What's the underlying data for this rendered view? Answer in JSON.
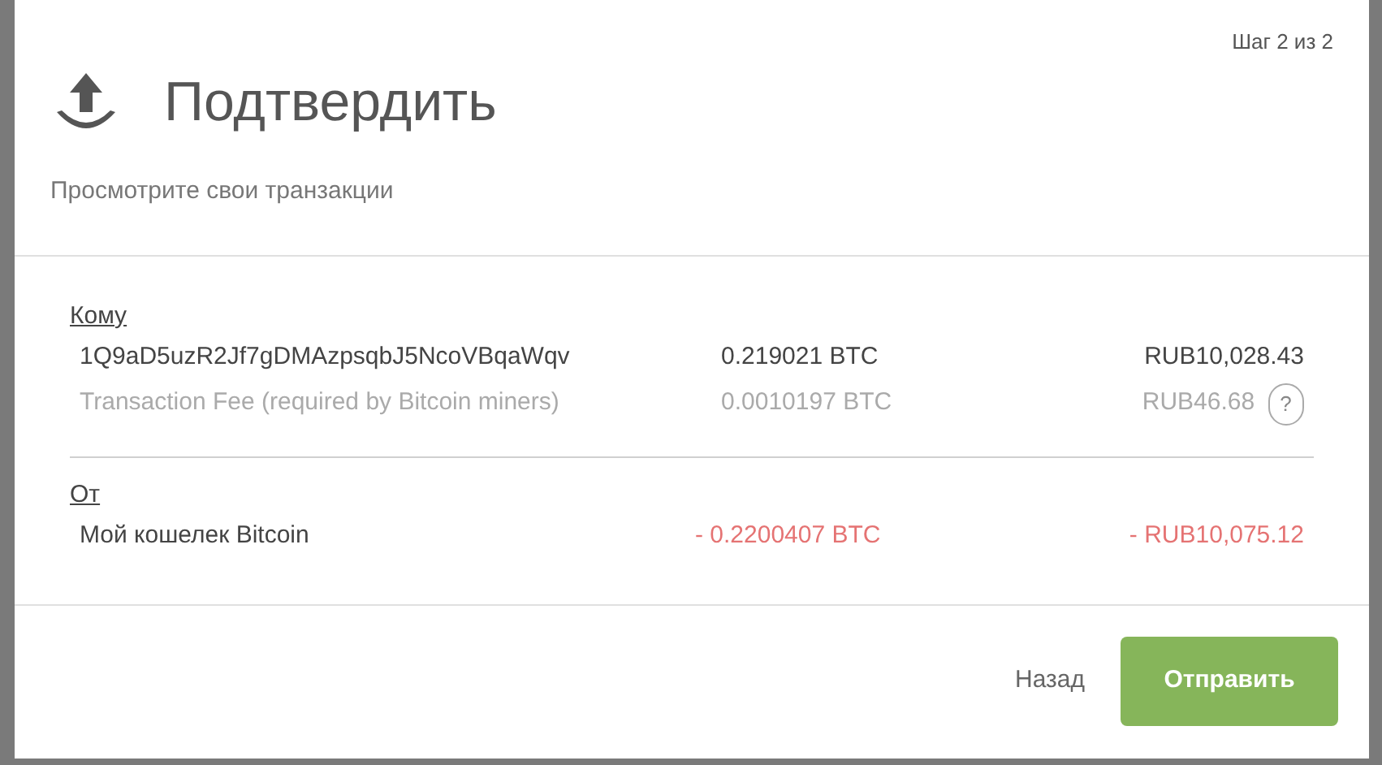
{
  "dialog": {
    "step": "Шаг 2 из 2",
    "title": "Подтвердить",
    "subtitle": "Просмотрите свои транзакции"
  },
  "sections": [
    {
      "heading": "Кому",
      "rows": [
        {
          "kind": "send",
          "label": "1Q9aD5uzR2Jf7gDMAzpsqbJ5NcoVBqaWqv",
          "amount": "0.219021 BTC",
          "fiat": "RUB10,028.43"
        },
        {
          "kind": "fee",
          "label": "Transaction Fee (required by Bitcoin miners)",
          "amount": "0.0010197 BTC",
          "fiat": "RUB46.68",
          "help": "?"
        }
      ]
    },
    {
      "heading": "От",
      "rows": [
        {
          "kind": "debit",
          "label": "Мой кошелек Bitcoin",
          "amount": "- 0.2200407 BTC",
          "fiat": "- RUB10,075.12"
        }
      ]
    }
  ],
  "buttons": {
    "back": "Назад",
    "send": "Отправить"
  }
}
